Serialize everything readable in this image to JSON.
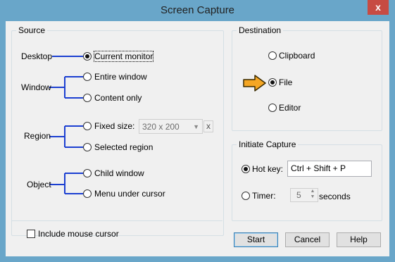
{
  "window": {
    "title": "Screen Capture",
    "close_glyph": "x"
  },
  "source": {
    "legend": "Source",
    "groups": [
      {
        "label": "Desktop",
        "options": [
          "Current monitor"
        ]
      },
      {
        "label": "Window",
        "options": [
          "Entire window",
          "Content only"
        ]
      },
      {
        "label": "Region",
        "options": [
          "Fixed size:",
          "Selected region"
        ]
      },
      {
        "label": "Object",
        "options": [
          "Child window",
          "Menu under cursor"
        ]
      }
    ],
    "fixed_size_value": "320 x 200",
    "fixed_size_clear": "x",
    "include_cursor": "Include mouse cursor",
    "selected": "Current monitor"
  },
  "destination": {
    "legend": "Destination",
    "options": [
      "Clipboard",
      "File",
      "Editor"
    ],
    "selected": "File"
  },
  "initiate": {
    "legend": "Initiate Capture",
    "hotkey_label": "Hot key:",
    "hotkey_value": "Ctrl + Shift + P",
    "timer_label": "Timer:",
    "timer_value": "5",
    "timer_unit": "seconds",
    "selected": "Hot key"
  },
  "buttons": {
    "start": "Start",
    "cancel": "Cancel",
    "help": "Help"
  },
  "colors": {
    "connector": "#1b3fd1",
    "arrow": "#f5a623",
    "title_bar": "#69a6c9",
    "close": "#c74b43"
  }
}
